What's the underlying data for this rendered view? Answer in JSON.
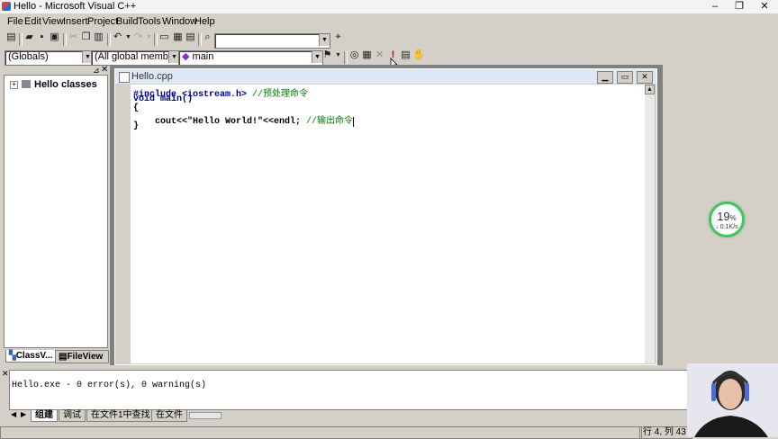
{
  "window": {
    "title": "Hello - Microsoft Visual C++",
    "controls": [
      "–",
      "❐",
      "✕"
    ]
  },
  "menubar": [
    {
      "label": "File",
      "key": "F"
    },
    {
      "label": "Edit",
      "key": "E"
    },
    {
      "label": "View",
      "key": "V"
    },
    {
      "label": "Insert",
      "key": "I"
    },
    {
      "label": "Project",
      "key": "P"
    },
    {
      "label": "Build",
      "key": "B"
    },
    {
      "label": "Tools",
      "key": "T"
    },
    {
      "label": "Window",
      "key": "W"
    },
    {
      "label": "Help",
      "key": "H"
    }
  ],
  "toolbar": {
    "search_value": "",
    "scope_combo": "(Globals)",
    "members_combo": "(All global members",
    "function_combo": "main"
  },
  "workspace": {
    "tree_root": "Hello classes",
    "tabs": [
      "ClassV...",
      "FileView"
    ]
  },
  "editor": {
    "tab_title": "Hello.cpp",
    "lines": [
      {
        "code": "#include <iostream.h> ",
        "comment": "//预处理命令"
      },
      {
        "code": "void main()",
        "comment": ""
      },
      {
        "code": "{",
        "comment": ""
      },
      {
        "code": "    cout<<\"Hello World!\"<<endl; ",
        "comment": "//输出命令"
      },
      {
        "code": "}",
        "comment": ""
      }
    ]
  },
  "output": {
    "text": "Hello.exe - 0 error(s), 0 warning(s)",
    "tabs": [
      "组建",
      "调试",
      "在文件1中查找",
      "在文件"
    ]
  },
  "statusbar": {
    "position": "行 4, 列 43"
  },
  "net_widget": {
    "percent": "19",
    "percent_unit": "%",
    "speed": "↓ 0.1K/s",
    "ring_color": "#3cc860"
  }
}
